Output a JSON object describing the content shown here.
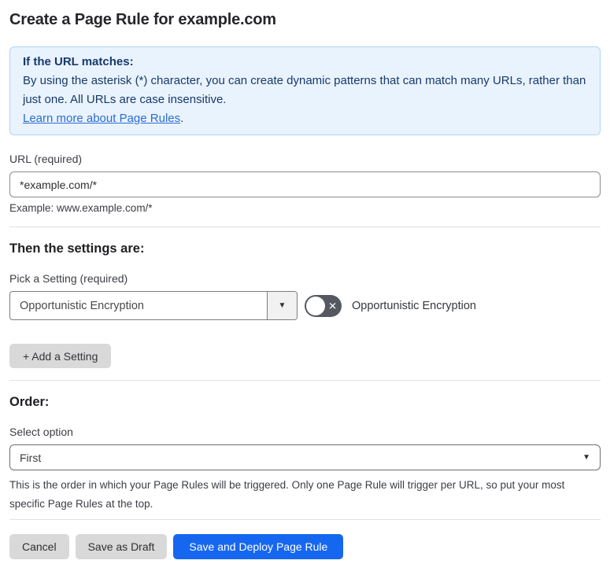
{
  "page": {
    "title": "Create a Page Rule for example.com"
  },
  "info_box": {
    "heading": "If the URL matches:",
    "body": "By using the asterisk (*) character, you can create dynamic patterns that can match many URLs, rather than just one. All URLs are case insensitive.",
    "link_label": "Learn more about Page Rules",
    "link_suffix": "."
  },
  "url_section": {
    "label": "URL (required)",
    "input_value": "*example.com/*",
    "helper": "Example: www.example.com/*"
  },
  "settings_section": {
    "heading": "Then the settings are:",
    "picker_label": "Pick a Setting (required)",
    "selected_setting": "Opportunistic Encryption",
    "toggle_state": "off",
    "toggle_label": "Opportunistic Encryption",
    "add_button_label": "+ Add a Setting"
  },
  "order_section": {
    "heading": "Order:",
    "select_label": "Select option",
    "selected_option": "First",
    "helper": "This is the order in which your Page Rules will be triggered. Only one Page Rule will trigger per URL, so put your most specific Page Rules at the top."
  },
  "footer": {
    "cancel_label": "Cancel",
    "save_draft_label": "Save as Draft",
    "save_deploy_label": "Save and Deploy Page Rule"
  },
  "icons": {
    "dropdown_arrow": "▼",
    "toggle_off_x": "✕"
  },
  "colors": {
    "primary_blue": "#1667f0",
    "info_bg": "#e9f3fd",
    "info_border": "#afd4f5",
    "info_text": "#17396b",
    "link_blue": "#2c6cd4",
    "toggle_off_bg": "#55595f",
    "button_gray": "#d9d9d9"
  }
}
